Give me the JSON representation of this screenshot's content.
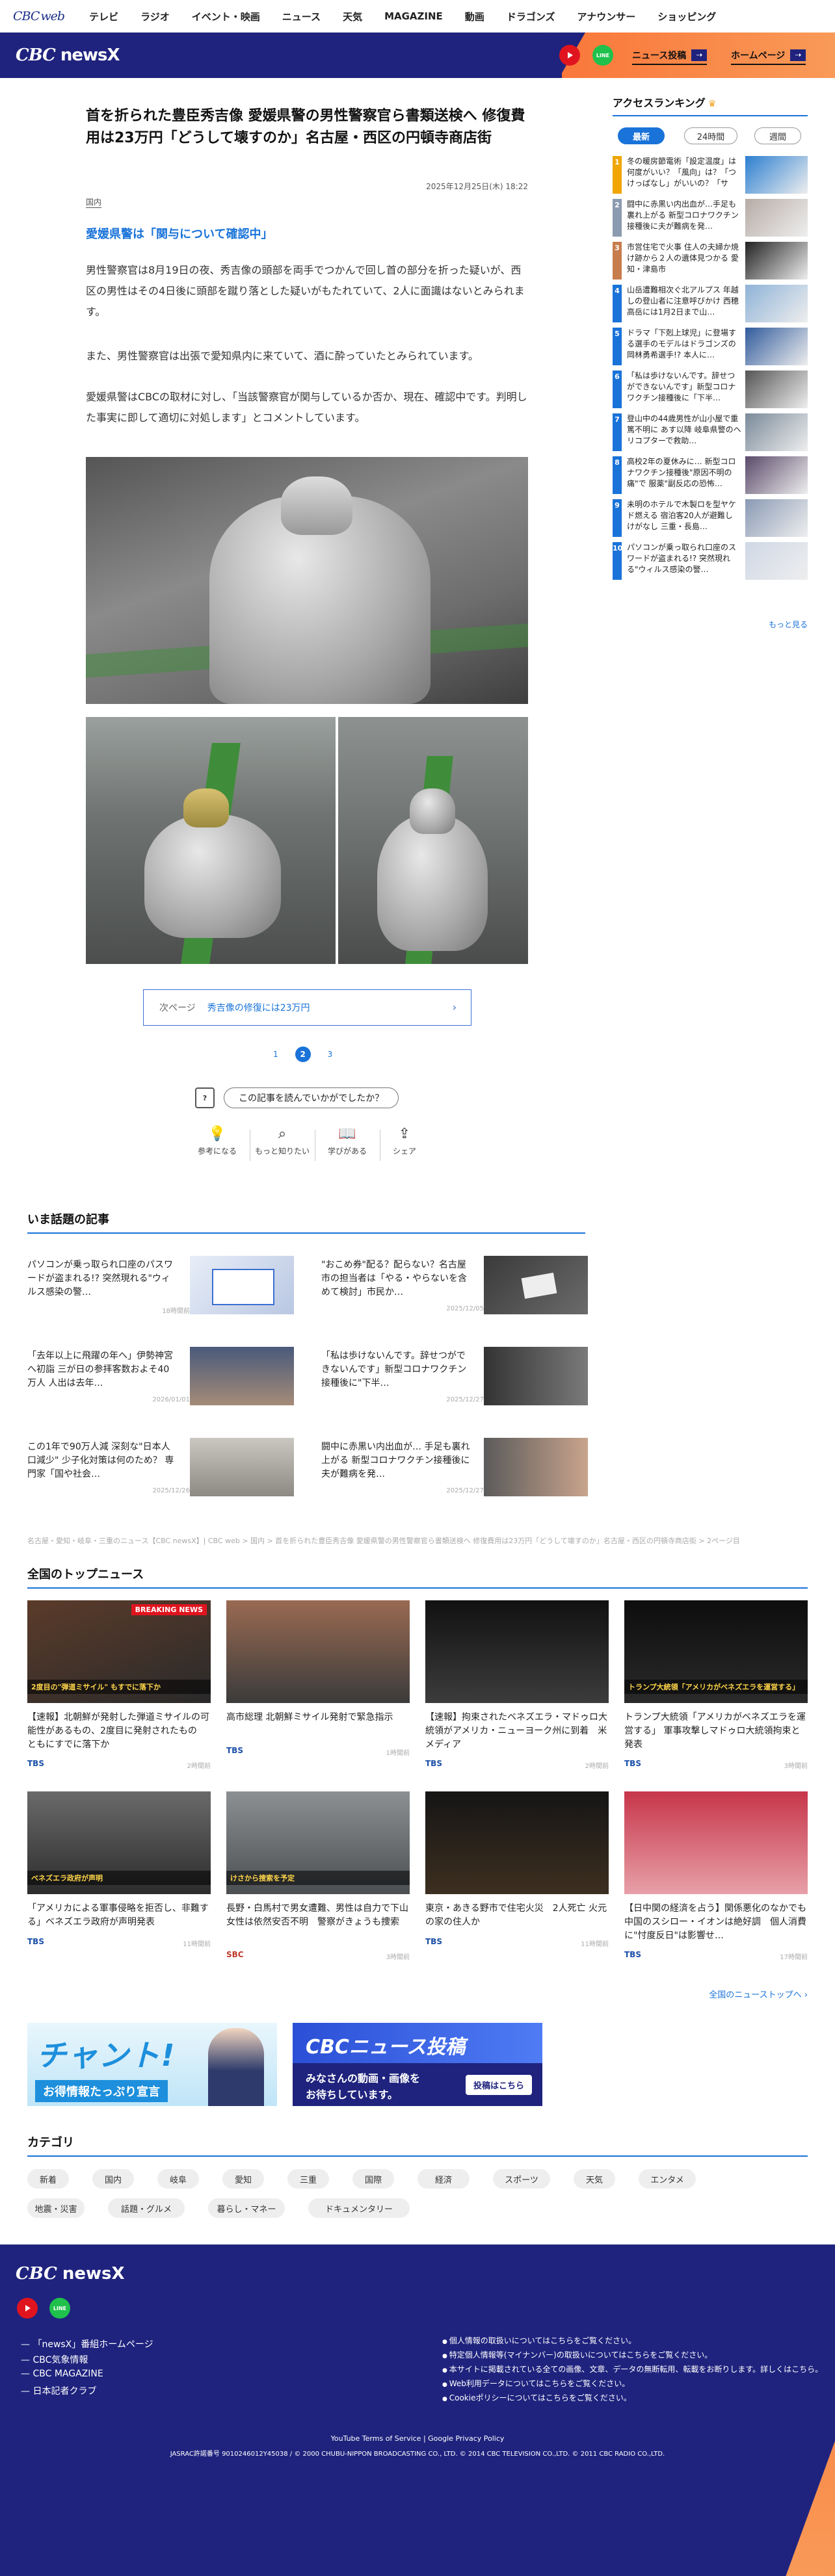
{
  "topnav": {
    "logo": "CBC",
    "logo_sub": "web",
    "items": [
      "テレビ",
      "ラジオ",
      "イベント・映画",
      "ニュース",
      "天気",
      "MAGAZINE",
      "動画",
      "ドラゴンズ",
      "アナウンサー",
      "ショッピング"
    ]
  },
  "header": {
    "brand": "CBC",
    "brand_sub": "newsX",
    "line_label": "LINE",
    "post_button": "ニュース投稿",
    "home_button": "ホームページ",
    "colors": {
      "navy": "#1f237e",
      "orange": "#f9773a"
    }
  },
  "article": {
    "title": "首を折られた豊臣秀吉像 愛媛県警の男性警察官ら書類送検へ 修復費用は23万円「どうして壊すのか」名古屋・西区の円頓寺商店街",
    "date": "2025年12月25日(木) 18:22",
    "category": "国内",
    "subheading": "愛媛県警は「関与について確認中」",
    "paragraphs": [
      "男性警察官は8月19日の夜、秀吉像の頭部を両手でつかんで回し首の部分を折った疑いが、西区の男性はその4日後に頭部を蹴り落とした疑いがもたれていて、2人に面識はないとみられます。",
      "また、男性警察官は出張で愛知県内に来ていて、酒に酔っていたとみられています。",
      "愛媛県警はCBCの取材に対し、「当該警察官が関与しているか否か、現在、確認中です。判明した事実に即して適切に対処します」とコメントしています。"
    ],
    "next_label": "次ページ",
    "next_title": "秀吉像の修復には23万円",
    "pages": [
      "1",
      "2",
      "3"
    ],
    "current_page": "2",
    "feedback_icon": "?",
    "feedback_button": "この記事を読んでいかがでしたか？",
    "reactions": [
      "参考になる",
      "もっと知りたい",
      "学びがある",
      "シェア"
    ]
  },
  "ranking": {
    "title": "アクセスランキング",
    "tabs": [
      "最新",
      "24時間",
      "週間"
    ],
    "items": [
      {
        "rank": "1",
        "title": "冬の暖房節電術「設定温度」は何度がいい？「風向」は？「つけっぱなし」がいいの？「サー…",
        "color": "#f0a500"
      },
      {
        "rank": "2",
        "title": "闘中に赤黒い内出血が…手足も裏れ上がる 新型コロナワクチン接種後に夫が難病を発…",
        "color": "#8b9bb0"
      },
      {
        "rank": "3",
        "title": "市営住宅で火事 住人の夫婦か焼け跡から２人の遺体見つかる 愛知・津島市",
        "color": "#c77d4d"
      },
      {
        "rank": "4",
        "title": "山岳遭難相次ぐ北アルプス 年越しの登山者に注意呼びかけ 西穂高岳には1月2日まで山…",
        "color": "#1a73d9"
      },
      {
        "rank": "5",
        "title": "ドラマ「下剋上球児」に登場する選手のモデルはドラゴンズの岡林勇希選手!? 本人に…",
        "color": "#1a73d9"
      },
      {
        "rank": "6",
        "title": "「私は歩けないんです。辞せつができないんです」新型コロナワクチン接種後に「下半…",
        "color": "#1a73d9"
      },
      {
        "rank": "7",
        "title": "登山中の44歳男性が山小屋で重篤不明に あす以降 岐阜県警のヘリコプターで救助…",
        "color": "#1a73d9"
      },
      {
        "rank": "8",
        "title": "高校2年の夏休みに… 新型コロナワクチン接種後\"原因不明の痛\"で 服薬\"副反応の恐怖…",
        "color": "#1a73d9"
      },
      {
        "rank": "9",
        "title": "未明のホテルで木製ロを型ヤケド燃える 宿泊客20人が避難し けがなし 三重・長島…",
        "color": "#1a73d9"
      },
      {
        "rank": "10",
        "title": "パソコンが乗っ取られ口座のスワードが盗まれる!? 突然現れる\"ウィルス感染の警…",
        "color": "#1a73d9"
      }
    ],
    "more": "もっと見る"
  },
  "hot_topics": {
    "title": "いま話題の記事",
    "items": [
      {
        "title": "パソコンが乗っ取られ口座のパスワードが盗まれる!? 突然現れる\"ウィルス感染の警…",
        "date": "18時間前"
      },
      {
        "title": "\"おこめ券\"配る？配らない？名古屋市の担当者は「やる・やらないを含めて検討」市民か…",
        "date": "2025/12/05"
      },
      {
        "title": "「去年以上に飛躍の年へ」伊勢神宮へ初詣 三が日の参拝客数およそ40万人 人出は去年…",
        "date": "2026/01/01"
      },
      {
        "title": "「私は歩けないんです。辞せつができないんです」新型コロナワクチン接種後に\"下半…",
        "date": "2025/12/27"
      },
      {
        "title": "この1年で90万人減 深刻な\"日本人口減少\" 少子化対策は何のため？ 専門家「国や社会…",
        "date": "2025/12/26"
      },
      {
        "title": "闘中に赤黒い内出血が… 手足も裏れ上がる 新型コロナワクチン接種後に夫が難病を発…",
        "date": "2025/12/27"
      }
    ]
  },
  "breadcrumb": "名古屋・愛知・岐阜・三重のニュース【CBC newsX】| CBC web > 国内 > 首を折られた豊臣秀吉像 愛媛県警の男性警察官ら書類送検へ 修復費用は23万円「どうして壊すのか」名古屋・西区の円頓寺商店街 > 2ページ目",
  "top_news": {
    "title": "全国のトップニュース",
    "items": [
      {
        "title": "【速報】北朝鮮が発射した弾道ミサイルの可能性があるもの、2度目に発射されたもの　ともにすでに落下か",
        "source": "TBS",
        "date": "2時間前",
        "badge": "BREAKING NEWS",
        "caption": "2度目の\"弾道ミサイル\" もすでに落下か"
      },
      {
        "title": "高市総理 北朝鮮ミサイル発射で緊急指示",
        "source": "TBS",
        "date": "1時間前",
        "badge": "",
        "caption": ""
      },
      {
        "title": "【速報】拘束されたベネズエラ・マドゥロ大統領がアメリカ・ニューヨーク州に到着　米メディア",
        "source": "TBS",
        "date": "2時間前",
        "badge": "",
        "caption": ""
      },
      {
        "title": "トランプ大統領「アメリカがベネズエラを運営する」 軍事攻撃しマドゥロ大統領拘束と発表",
        "source": "TBS",
        "date": "3時間前",
        "badge": "",
        "caption": "トランプ大統領「アメリカがベネズエラを運営する」"
      },
      {
        "title": "「アメリカによる軍事侵略を拒否し、非難する」ベネズエラ政府が声明発表",
        "source": "TBS",
        "date": "11時間前",
        "badge": "",
        "caption": "ベネズエラ政府が声明"
      },
      {
        "title": "長野・白馬村で男女遭難、男性は自力で下山 女性は依然安否不明　警察がきょうも捜索",
        "source": "SBC",
        "date": "3時間前",
        "badge": "",
        "caption": "けさから捜索を予定"
      },
      {
        "title": "東京・あきる野市で住宅火災　2人死亡 火元の家の住人か",
        "source": "TBS",
        "date": "11時間前",
        "badge": "",
        "caption": ""
      },
      {
        "title": "【日中関の経済を占う】関係悪化のなかでも中国のスシロー・イオンは絶好調　個人消費に\"忖度反日\"は影響せ…",
        "source": "TBS",
        "date": "17時間前",
        "badge": "",
        "caption": ""
      }
    ],
    "more": "全国のニューストップへ"
  },
  "banners": {
    "chant_big": "チャント!",
    "chant_small": "お得情報たっぷり宣言",
    "post_top": "CBCニュース投稿",
    "post_l1": "みなさんの動画・画像を",
    "post_l2": "お待ちしています。",
    "post_btn": "投稿はこちら"
  },
  "categories": {
    "title": "カテゴリ",
    "items": [
      "新着",
      "国内",
      "岐阜",
      "愛知",
      "三重",
      "国際",
      "経済",
      "スポーツ",
      "天気",
      "エンタメ",
      "地震・災害",
      "話題・グルメ",
      "暮らし・マネー",
      "ドキュメンタリー"
    ]
  },
  "footer": {
    "brand": "CBC",
    "brand_sub": "newsX",
    "line_label": "LINE",
    "links": [
      "「newsX」番組ホームページ",
      "CBC気象情報",
      "CBC MAGAZINE",
      "日本記者クラブ"
    ],
    "policies": [
      "個人情報の取扱いについてはこちらをご覧ください。",
      "特定個人情報等(マイナンバー)の取扱いについてはこちらをご覧ください。",
      "本サイトに掲載されている全ての画像、文章、データの無断転用、転載をお断りします。詳しくはこちら。",
      "Web利用データについてはこちらをご覧ください。",
      "Cookieポリシーについてはこちらをご覧ください。"
    ],
    "yt_terms": "YouTube Terms of Service",
    "google_privacy": "Google Privacy Policy",
    "copyright": "JASRAC許諾番号 9010246012Y45038 / © 2000 CHUBU-NIPPON BROADCASTING CO., LTD. © 2014 CBC TELEVISION CO.,LTD. © 2011 CBC RADIO CO.,LTD."
  }
}
